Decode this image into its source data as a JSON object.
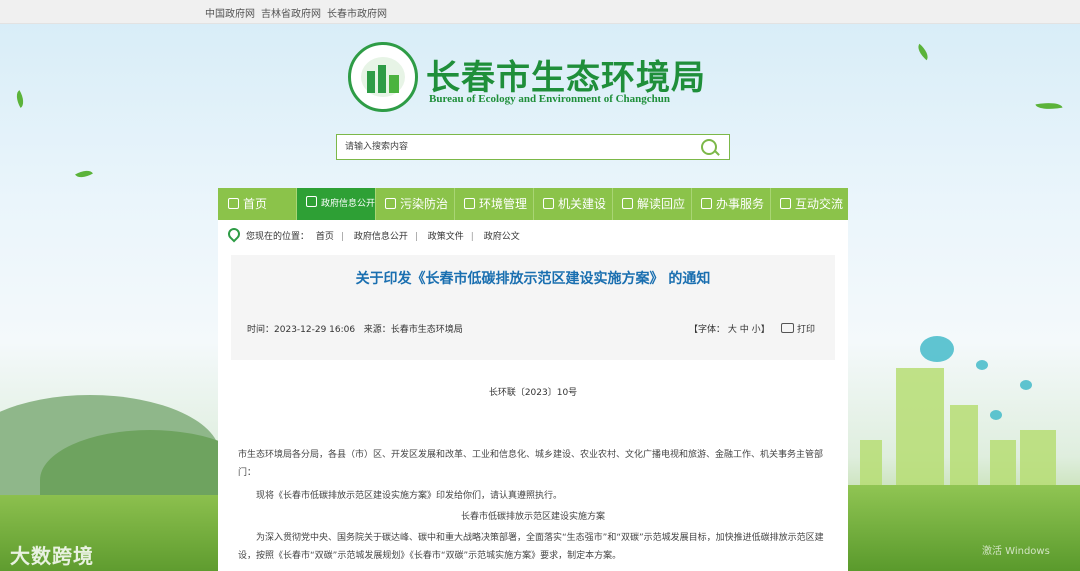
{
  "top_links": [
    "中国政府网",
    "吉林省政府网",
    "长春市政府网"
  ],
  "site": {
    "title_cn": "长春市生态环境局",
    "title_en": "Bureau of Ecology and Environment of Changchun"
  },
  "search": {
    "placeholder": "请输入搜索内容",
    "icon": "search-icon"
  },
  "nav": [
    {
      "label": "首页",
      "icon": "home-icon"
    },
    {
      "label": "政府信息公开",
      "icon": "info-icon",
      "active": true
    },
    {
      "label": "污染防治",
      "icon": "drop-icon"
    },
    {
      "label": "环境管理",
      "icon": "leaf-icon"
    },
    {
      "label": "机关建设",
      "icon": "building-icon"
    },
    {
      "label": "解读回应",
      "icon": "chat-icon"
    },
    {
      "label": "办事服务",
      "icon": "doc-icon"
    },
    {
      "label": "互动交流",
      "icon": "interact-icon"
    }
  ],
  "location": {
    "label": "您现在的位置：",
    "crumbs": [
      "首页",
      "政府信息公开",
      "政策文件",
      "政府公文"
    ]
  },
  "article": {
    "title": "关于印发《长春市低碳排放示范区建设实施方案》 的通知",
    "time_label": "时间：",
    "time": "2023-12-29 16:06",
    "source_label": "来源：",
    "source": "长春市生态环境局",
    "font_label": "【字体：",
    "font_large": "大",
    "font_medium": "中",
    "font_small": "小",
    "font_end": "】",
    "print_label": "打印",
    "doc_number": "长环联〔2023〕10号",
    "para1": "市生态环境局各分局，各县（市）区、开发区发展和改革、工业和信息化、城乡建设、农业农村、文化广播电视和旅游、金融工作、机关事务主管部门：",
    "para2": "现将《长春市低碳排放示范区建设实施方案》印发给你们，请认真遵照执行。",
    "subtitle": "长春市低碳排放示范区建设实施方案",
    "para3": "为深入贯彻党中央、国务院关于碳达峰、碳中和重大战略决策部署，全面落实“生态强市”和“双碳”示范城发展目标，加快推进低碳排放示范区建设，按照《长春市“双碳”示范城发展规划》《长春市“双碳”示范城实施方案》要求，制定本方案。"
  },
  "watermark": "大数跨境",
  "os_watermark": "激活 Windows"
}
